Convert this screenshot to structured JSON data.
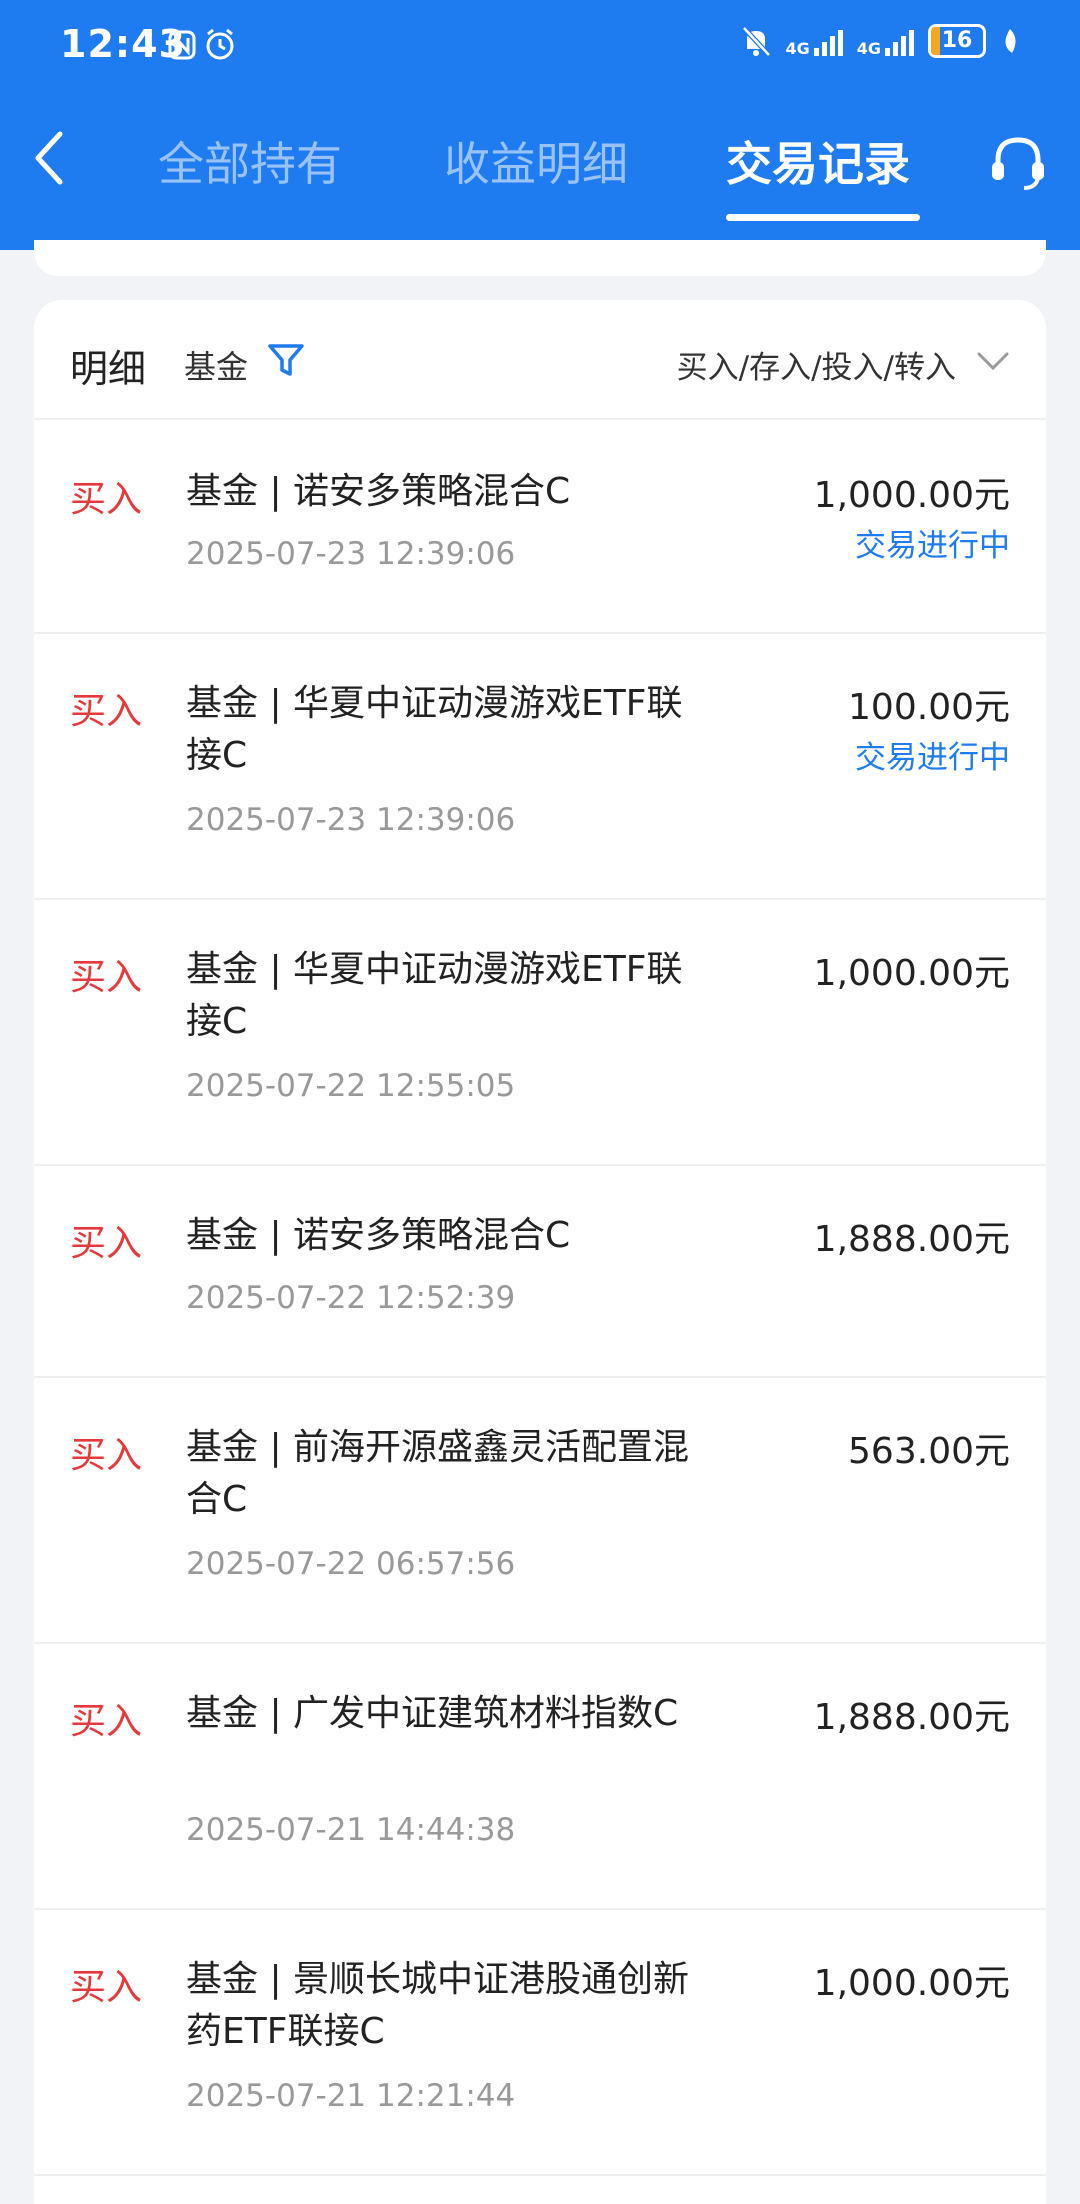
{
  "status_bar": {
    "time": "12:43",
    "network_1": "4G",
    "network_2": "4G",
    "battery": "16"
  },
  "nav": {
    "tabs": [
      "全部持有",
      "收益明细",
      "交易记录"
    ],
    "active_tab": "交易记录"
  },
  "filter": {
    "title": "明细",
    "category": "基金",
    "type": "买入/存入/投入/转入"
  },
  "records": [
    {
      "type": "买入",
      "name": "基金 | 诺安多策略混合C",
      "time": "2025-07-23 12:39:06",
      "amount": "1,000.00元",
      "status": "交易进行中"
    },
    {
      "type": "买入",
      "name": "基金 | 华夏中证动漫游戏ETF联接C",
      "time": "2025-07-23 12:39:06",
      "amount": "100.00元",
      "status": "交易进行中"
    },
    {
      "type": "买入",
      "name": "基金 | 华夏中证动漫游戏ETF联接C",
      "time": "2025-07-22 12:55:05",
      "amount": "1,000.00元",
      "status": ""
    },
    {
      "type": "买入",
      "name": "基金 | 诺安多策略混合C",
      "time": "2025-07-22 12:52:39",
      "amount": "1,888.00元",
      "status": ""
    },
    {
      "type": "买入",
      "name": "基金 | 前海开源盛鑫灵活配置混合C",
      "time": "2025-07-22 06:57:56",
      "amount": "563.00元",
      "status": ""
    },
    {
      "type": "买入",
      "name": "基金 | 广发中证建筑材料指数C",
      "time": "2025-07-21 14:44:38",
      "amount": "1,888.00元",
      "status": ""
    },
    {
      "type": "买入",
      "name": "基金 | 景顺长城中证港股通创新药ETF联接C",
      "time": "2025-07-21 12:21:44",
      "amount": "1,000.00元",
      "status": ""
    }
  ],
  "colors": {
    "brand_blue": "#1e7bf0",
    "buy_red": "#e5393b",
    "status_blue": "#1e7bf0"
  }
}
